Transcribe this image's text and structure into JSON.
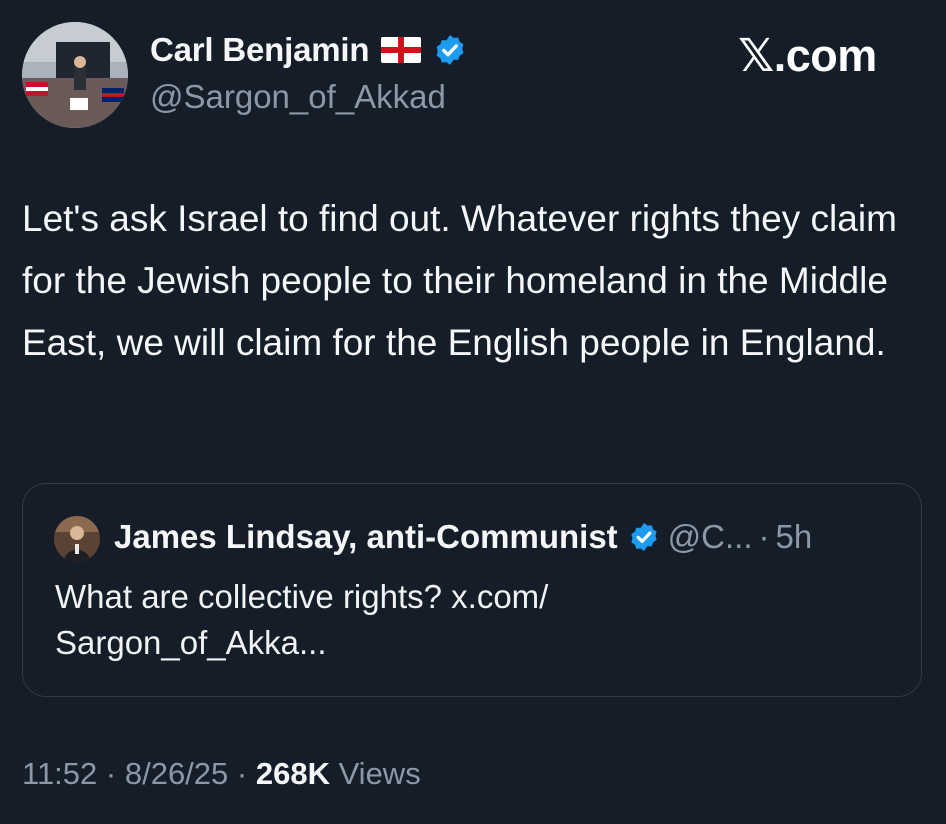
{
  "author": {
    "display_name": "Carl Benjamin",
    "handle": "@Sargon_of_Akkad",
    "flag_icon": "england-flag-icon",
    "verified_icon": "verified-badge-icon"
  },
  "brand": {
    "text": ".com",
    "logo_icon": "x-logo-icon"
  },
  "tweet": {
    "text": "Let's ask Israel to find out. Whatever rights they claim for the Jewish people to their homeland in the Middle East, we will claim for the English people in England."
  },
  "quoted_tweet": {
    "display_name": "James Lindsay, anti-Communist",
    "handle": "@C...",
    "separator": "·",
    "time": "5h",
    "text_line1": "What are collective rights? x.com/",
    "text_line2": "Sargon_of_Akka..."
  },
  "meta": {
    "time": "11:52",
    "sep1": " · ",
    "date": "8/26/25",
    "sep2": " · ",
    "views_count": "268K",
    "views_label": " Views"
  },
  "colors": {
    "background": "#151d28",
    "verified_blue": "#1d9bf0",
    "secondary_text": "#8b98a5",
    "card_border": "#2f3a47"
  }
}
